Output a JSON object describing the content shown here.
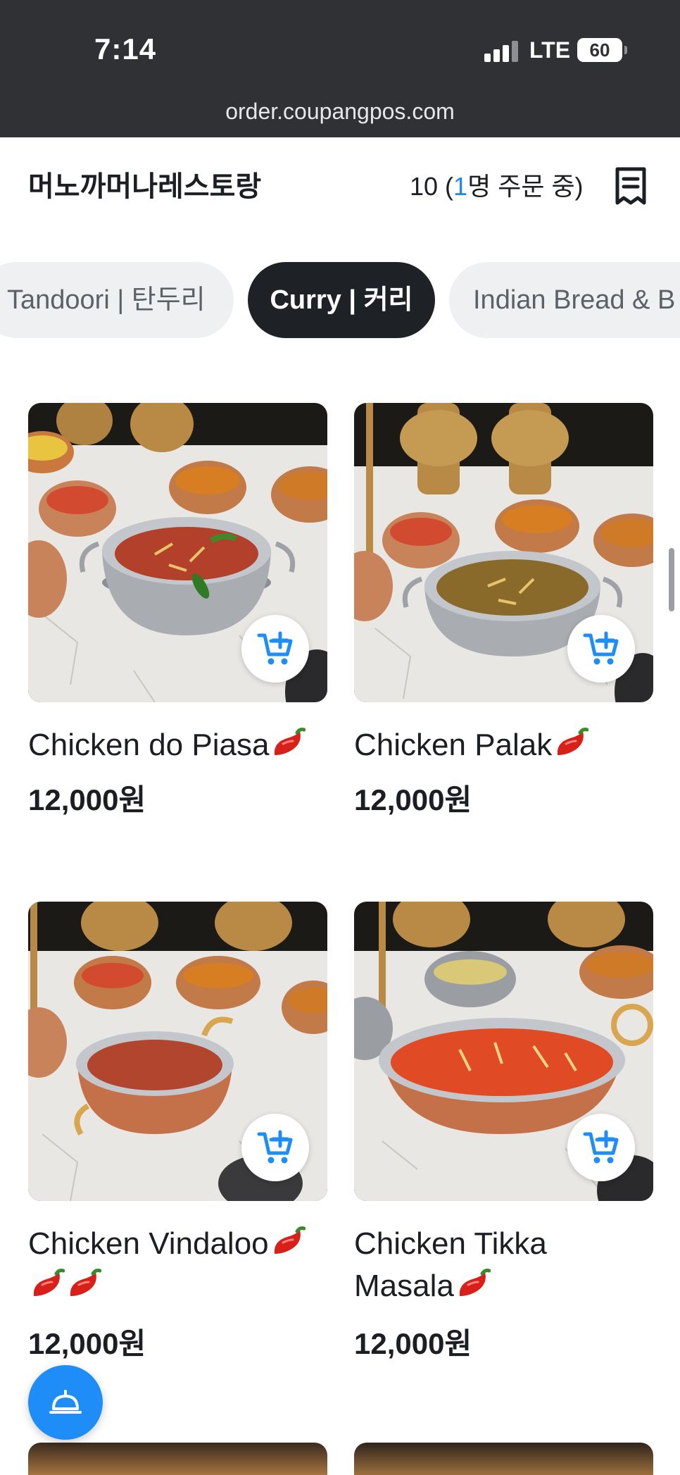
{
  "status_bar": {
    "time": "7:14",
    "network": "LTE",
    "battery": "60"
  },
  "browser": {
    "url": "order.coupangpos.com"
  },
  "header": {
    "store_name": "머노까머나레스토랑",
    "table_prefix": "10 (",
    "ordering_count": "1",
    "ordering_suffix": "명 주문 중)"
  },
  "categories": [
    {
      "label": "Tandoori | 탄두리",
      "selected": false
    },
    {
      "label": "Curry | 커리",
      "selected": true
    },
    {
      "label": "Indian Bread & B",
      "selected": false
    }
  ],
  "menu_items": [
    {
      "name": "Chicken do Piasa",
      "spice_level": 1,
      "price": "12,000원",
      "curry_color": "#b2402a"
    },
    {
      "name": "Chicken Palak",
      "spice_level": 1,
      "price": "12,000원",
      "curry_color": "#8a6a2a"
    },
    {
      "name": "Chicken Vindaloo",
      "spice_level": 3,
      "price": "12,000원",
      "curry_color": "#b2452e"
    },
    {
      "name": "Chicken Tikka Masala",
      "name_line1": "Chicken Tikka",
      "name_line2": "Masala",
      "spice_level": 1,
      "price": "12,000원",
      "curry_color": "#e04a24"
    }
  ],
  "icons": {
    "add_to_cart": "cart-plus-icon",
    "receipt": "receipt-icon",
    "chili": "chili-pepper-icon",
    "call_staff": "service-bell-icon"
  },
  "colors": {
    "accent": "#1f8df8",
    "selected_tab": "#1e2125",
    "status_bar": "#2f3134"
  }
}
